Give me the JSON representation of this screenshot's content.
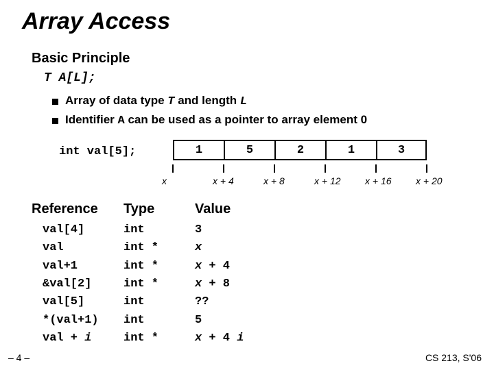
{
  "title": "Array Access",
  "section": "Basic Principle",
  "decl": {
    "T": "T",
    "mid": " A[",
    "L": "L",
    "end": "];"
  },
  "bullets": [
    {
      "pre": "Array of data type ",
      "em1": "T",
      "mid": " and length ",
      "em2": "L"
    },
    {
      "pre": "Identifier ",
      "code": "A",
      "post": " can be used as a pointer to array element 0"
    }
  ],
  "arrdecl": "int val[5];",
  "cells": [
    "1",
    "5",
    "2",
    "1",
    "3"
  ],
  "ticks": [
    "x",
    "x + 4",
    "x + 8",
    "x + 12",
    "x + 16",
    "x + 20"
  ],
  "table": {
    "headers": [
      "Reference",
      "Type",
      "Value"
    ],
    "rows": [
      {
        "ref": "val[4]",
        "type": "int",
        "val": "3"
      },
      {
        "ref": "val",
        "type": "int *",
        "val_ital": "x"
      },
      {
        "ref": "val+1",
        "type": "int *",
        "val_ital": "x",
        "val_post": " + 4"
      },
      {
        "ref": "&val[2]",
        "type": "int *",
        "val_ital": "x",
        "val_post": " + 8"
      },
      {
        "ref": "val[5]",
        "type": "int",
        "val": "??"
      },
      {
        "ref": "*(val+1)",
        "type": "int",
        "val": "5"
      },
      {
        "ref_pre": "val + ",
        "ref_ital": "i",
        "type": "int *",
        "val_ital": "x",
        "val_post": " + 4 ",
        "val_ital2": "i"
      }
    ]
  },
  "pgnum": "– 4 –",
  "footer": "CS 213, S'06"
}
